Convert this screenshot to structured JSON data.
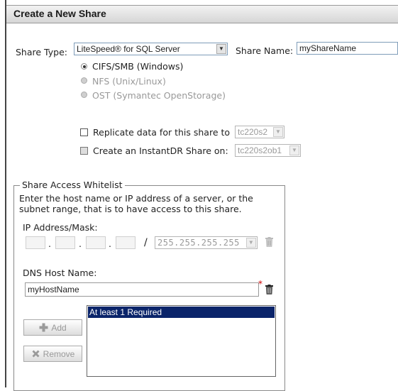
{
  "header": {
    "title": "Create a New Share"
  },
  "share_type": {
    "label": "Share Type:",
    "selected": "LiteSpeed® for SQL Server",
    "options": [
      {
        "label": "CIFS/SMB (Windows)",
        "checked": true,
        "disabled": false
      },
      {
        "label": "NFS (Unix/Linux)",
        "checked": false,
        "disabled": true
      },
      {
        "label": "OST (Symantec OpenStorage)",
        "checked": false,
        "disabled": true
      }
    ]
  },
  "share_name": {
    "label": "Share Name:",
    "value": "myShareName"
  },
  "replicate": {
    "label": "Replicate data for this share to",
    "target": "tc220s2",
    "checked": false,
    "disabled": false
  },
  "instantdr": {
    "label": "Create an InstantDR Share on:",
    "target": "tc220s2ob1",
    "checked": false,
    "disabled": true
  },
  "whitelist": {
    "legend": "Share Access Whitelist",
    "description_line1": "Enter the host name or IP address of a server, or the",
    "description_line2": "subnet range, that is to have access to this share.",
    "ip_label": "IP Address/Mask:",
    "ip_separator": "/",
    "mask_value": "255.255.255.255",
    "dns_label": "DNS Host Name:",
    "dns_value": "myHostName",
    "required_marker": "*",
    "add_label": "Add",
    "remove_label": "Remove",
    "list_items": [
      "At least 1 Required"
    ]
  },
  "colors": {
    "selection": "#0a246a",
    "required": "#cc0000",
    "header_text": "#1a1a1a"
  }
}
